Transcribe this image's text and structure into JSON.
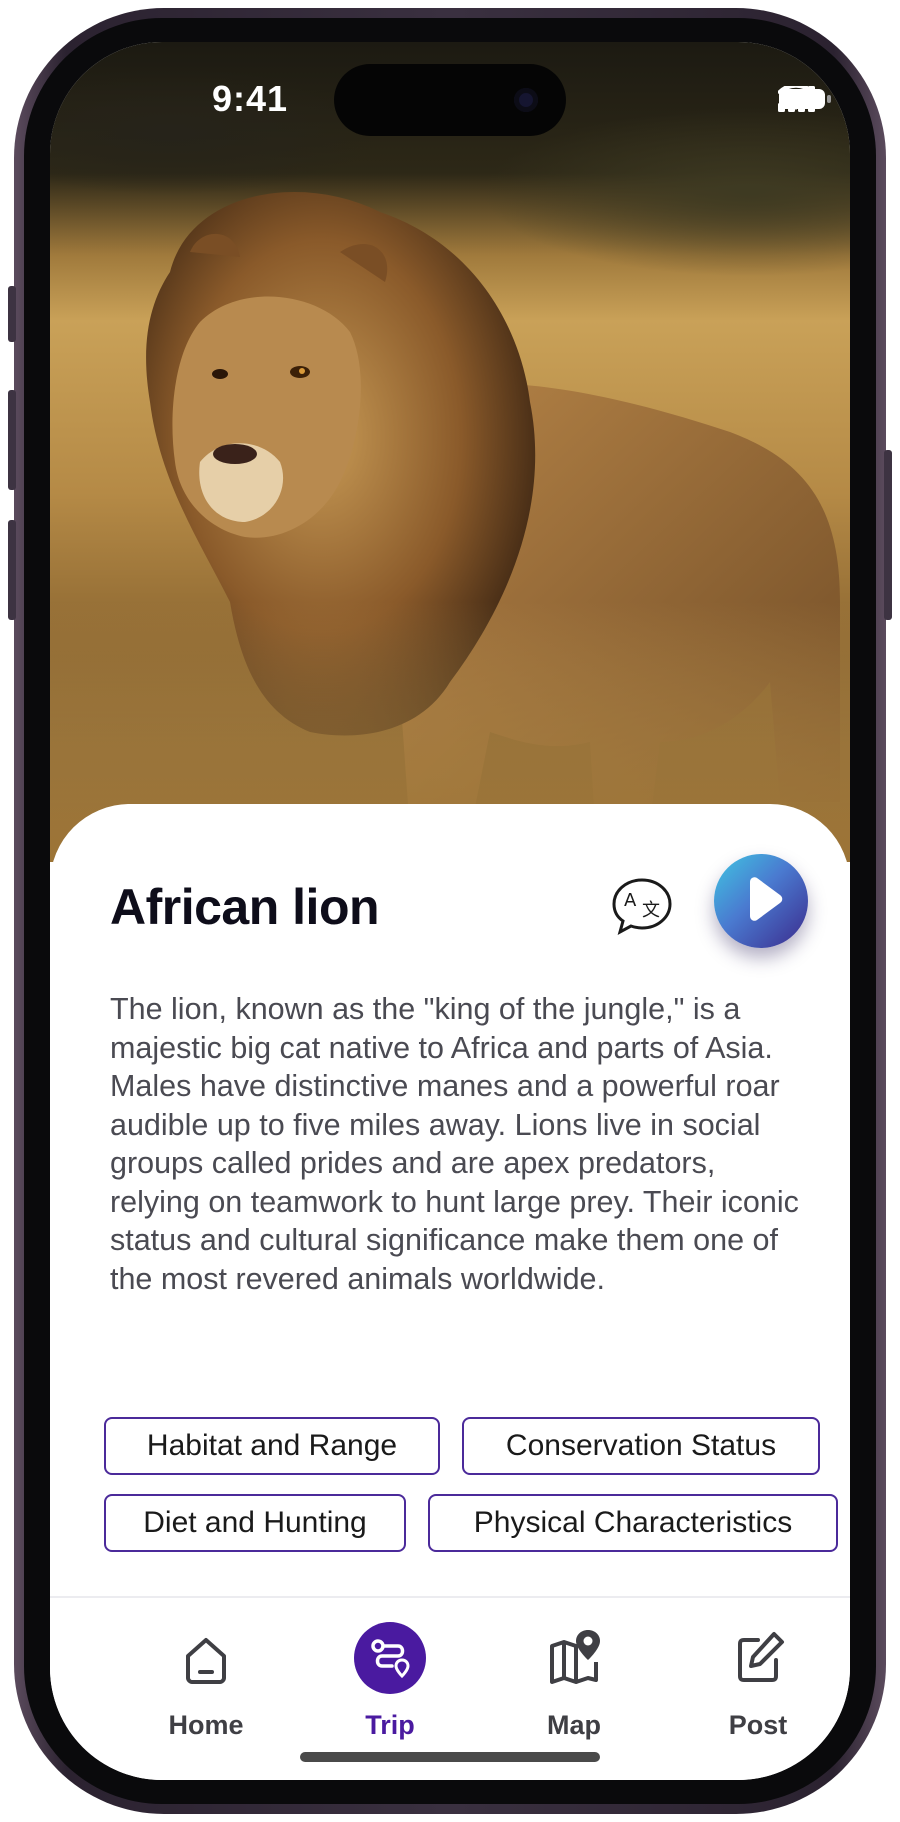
{
  "status_bar": {
    "time": "9:41"
  },
  "animal": {
    "name": "African lion",
    "description": "The lion, known as the \"king of the jungle,\" is a majestic big cat native to Africa and parts of Asia. Males have distinctive manes and a powerful roar audible up to five miles away. Lions live in social groups called prides and are apex predators, relying on teamwork to hunt large prey. Their iconic status and cultural significance make them one of the most revered animals worldwide."
  },
  "actions": {
    "translate_icon": "translate-icon",
    "play_icon": "play-icon"
  },
  "topics": [
    "Habitat and Range",
    "Conservation Status",
    "Diet and Hunting",
    "Physical Characteristics"
  ],
  "nav": {
    "items": [
      {
        "label": "Home",
        "icon": "home-icon"
      },
      {
        "label": "Trip",
        "icon": "route-icon",
        "active": true
      },
      {
        "label": "Map",
        "icon": "map-pin-icon"
      },
      {
        "label": "Post",
        "icon": "edit-icon"
      }
    ]
  },
  "colors": {
    "accent": "#4a1aa0",
    "chip_border": "#4b2a9a",
    "play_gradient_start": "#3fc6e2",
    "play_gradient_end": "#3b2a8c"
  }
}
